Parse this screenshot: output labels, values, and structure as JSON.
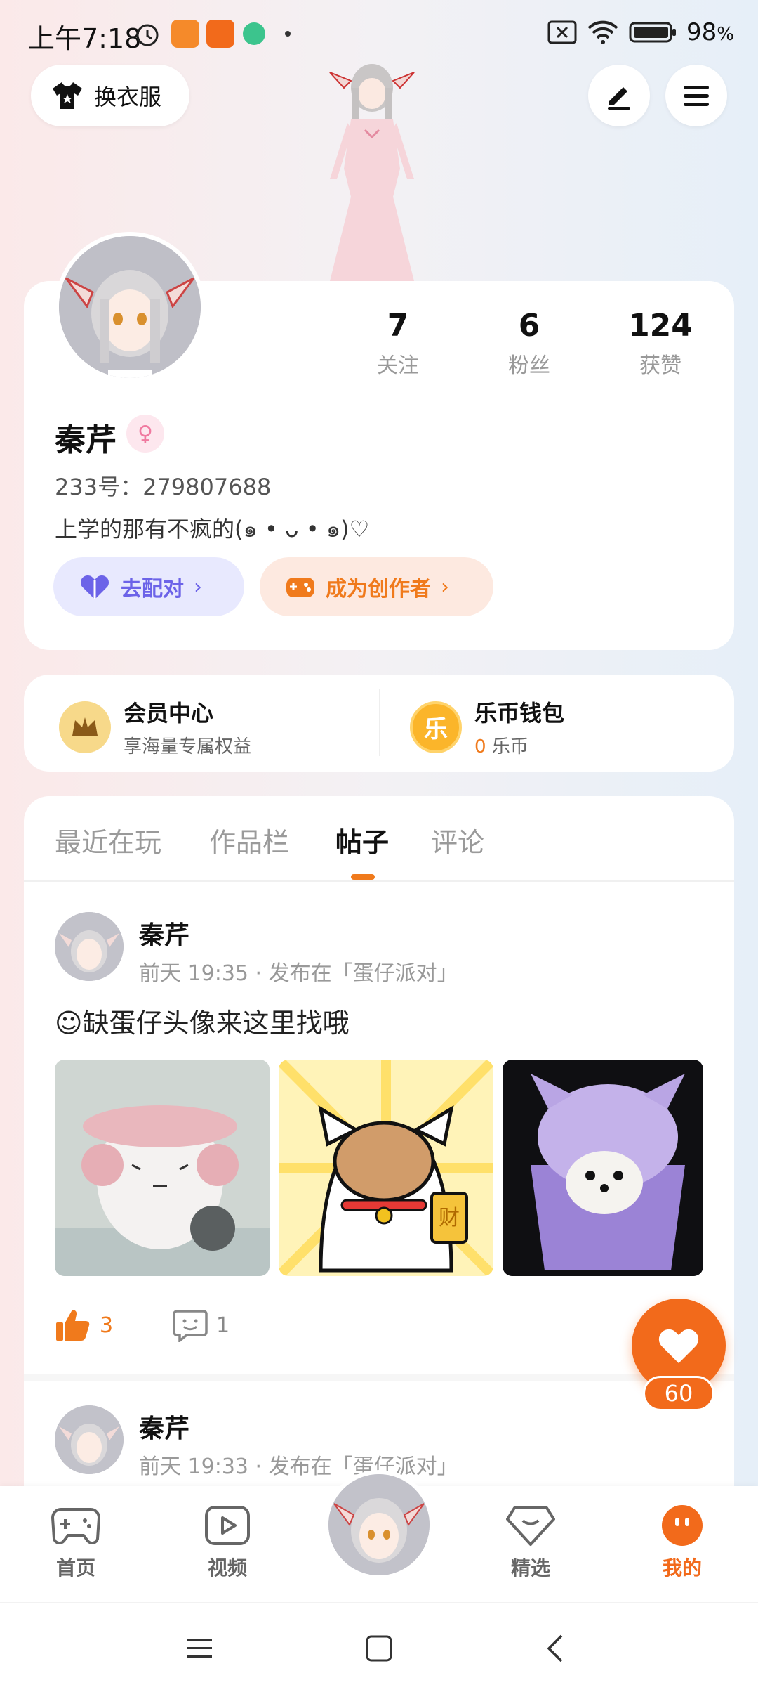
{
  "status_bar": {
    "time": "上午7:18",
    "battery": "98"
  },
  "top": {
    "outfit_label": "换衣服"
  },
  "profile": {
    "stats": [
      {
        "value": "7",
        "label": "关注"
      },
      {
        "value": "6",
        "label": "粉丝"
      },
      {
        "value": "124",
        "label": "获赞"
      }
    ],
    "name": "秦芹",
    "uid": "233号：279807688",
    "bio": "上学的那有不疯的(๑ • ᴗ • ๑)♡",
    "match_label": "去配对",
    "creator_label": "成为创作者"
  },
  "member": {
    "title": "会员中心",
    "subtitle": "享海量专属权益"
  },
  "wallet": {
    "title": "乐币钱包",
    "icon_char": "乐",
    "amount": "0",
    "unit": "乐币"
  },
  "tabs": [
    "最近在玩",
    "作品栏",
    "帖子",
    "评论"
  ],
  "posts": [
    {
      "author": "秦芹",
      "time": "前天 19:35",
      "sep": "·",
      "where": "发布在「蛋仔派对」",
      "text": "☺缺蛋仔头像来这里找哦",
      "likes": "3",
      "comments": "1"
    },
    {
      "author": "秦芹",
      "time": "前天 19:33",
      "sep": "·",
      "where": "发布在「蛋仔派对」"
    }
  ],
  "thumb_texts": {
    "fortune": "财"
  },
  "fab": {
    "count": "60"
  },
  "nav": {
    "home": "首页",
    "video": "视频",
    "featured": "精选",
    "mine": "我的"
  },
  "colors": {
    "accent": "#f26a1b",
    "match": "#6c63e8",
    "creator": "#f07a1c"
  }
}
